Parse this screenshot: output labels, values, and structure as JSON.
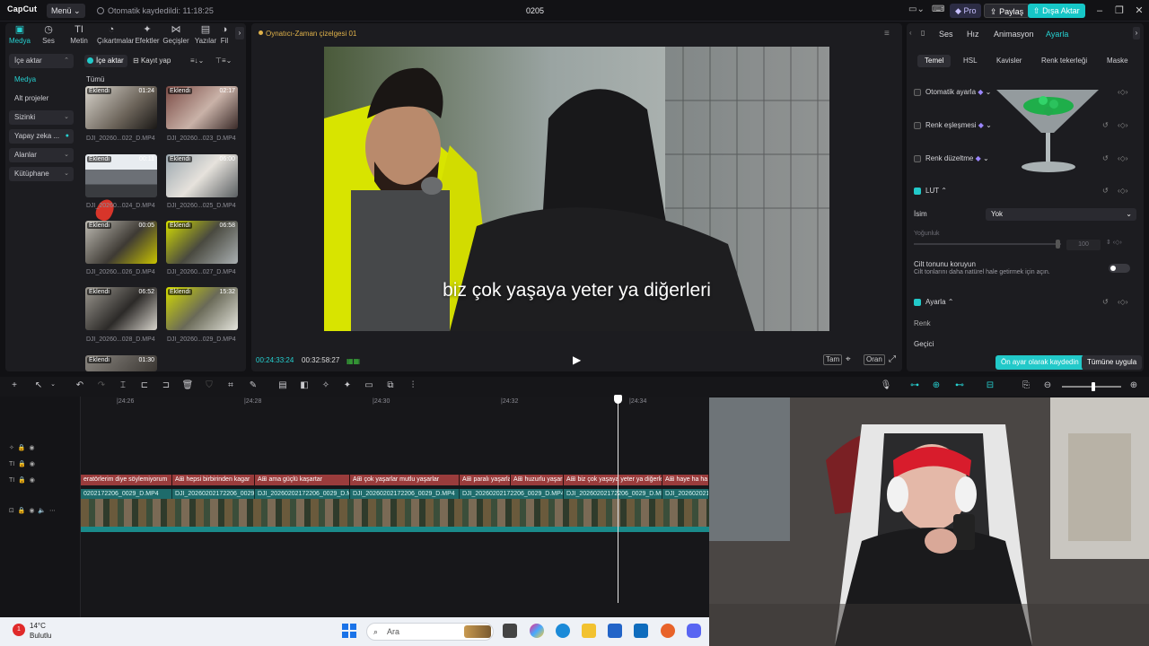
{
  "app": {
    "logo": "CapCut",
    "menu_label": "Menü",
    "autosave": "Otomatik kaydedildi: 11:18:25",
    "project_title": "0205",
    "pro_label": "Pro",
    "share_label": "Paylaş",
    "export_label": "Dışa Aktar"
  },
  "tool_tabs": [
    "Medya",
    "Ses",
    "Metin",
    "Çıkartmalar",
    "Efektler",
    "Geçişler",
    "Yazılar",
    "Fil"
  ],
  "side_nav": [
    "İçe aktar",
    "Medya",
    "Alt projeler",
    "Sizinki",
    "Yapay zeka ...",
    "Alanlar",
    "Kütüphane"
  ],
  "media": {
    "import_label": "İçe aktar",
    "record_label": "Kayıt yap",
    "all_label": "Tümü",
    "badge": "Eklendi",
    "items": [
      {
        "name": "DJI_20260...022_D.MP4",
        "duration": "01:24"
      },
      {
        "name": "DJI_20260...023_D.MP4",
        "duration": "02:17"
      },
      {
        "name": "DJI_20260...024_D.MP4",
        "duration": "00:11"
      },
      {
        "name": "DJI_20260...025_D.MP4",
        "duration": "06:00"
      },
      {
        "name": "DJI_20260...026_D.MP4",
        "duration": "00:05"
      },
      {
        "name": "DJI_20260...027_D.MP4",
        "duration": "06:58"
      },
      {
        "name": "DJI_20260...028_D.MP4",
        "duration": "06:52"
      },
      {
        "name": "DJI_20260...029_D.MP4",
        "duration": "15:32"
      },
      {
        "name": "",
        "duration": "01:30"
      }
    ]
  },
  "player": {
    "title": "Oynatıcı-Zaman çizelgesi 01",
    "subtitle": "biz çok yaşaya yeter ya diğerleri",
    "current_time": "00:24:33:24",
    "total_time": "00:32:58:27",
    "full_label": "Tam",
    "ratio_label": "Oran"
  },
  "right_panel": {
    "tabs": [
      "Ses",
      "Hız",
      "Animasyon",
      "Ayarla"
    ],
    "sub_tabs": [
      "Temel",
      "HSL",
      "Kavisler",
      "Renk tekerleği",
      "Maske"
    ],
    "auto_adjust": "Otomatik ayarla",
    "color_match": "Renk eşleşmesi",
    "color_correct": "Renk düzeltme",
    "lut": "LUT",
    "name_label": "İsim",
    "lut_value": "Yok",
    "intensity_label": "Yoğunluk",
    "intensity_value": "100",
    "skin_title": "Cilt tonunu koruyun",
    "skin_desc": "Cilt tonlarını daha natürel hale getirmek için açın.",
    "adjust": "Ayarla",
    "color_label": "Renk",
    "temp_label": "Geçici",
    "save_preset": "Ön ayar olarak kaydedin",
    "apply_all": "Tümüne uygula"
  },
  "timeline": {
    "ruler": [
      "|24:26",
      "|24:28",
      "|24:30",
      "|24:32",
      "|24:34"
    ],
    "text_clips": [
      "eratörlerim diye söylemiyorum",
      "A⊞ hepsi birbirinden kagar",
      "A⊞ ama güçlü kaşartar",
      "A⊞ çok yaşarlar mutlu yaşarlar",
      "A⊞ paralı yaşarlar",
      "A⊞ huzurlu yaşarlar",
      "A⊞ biz çok yaşaya yeter ya diğerleri",
      "A⊞ haye ha ha"
    ],
    "video_clips": [
      "0202172206_0029_D.MP4",
      "DJI_20260202172206_0029_D.MP4",
      "DJI_20260202172206_0029_D.MP4",
      "DJI_20260202172206_0029_D.MP4",
      "DJI_20260202172206_0029_D.MP4",
      "DJI_20260202172206_0029_D.MP4",
      "DJI_20260202172206_0029_D.MP4"
    ]
  },
  "taskbar": {
    "weather_temp": "14°C",
    "weather_desc": "Bulutlu",
    "notification_count": "1",
    "search_placeholder": "Ara"
  }
}
